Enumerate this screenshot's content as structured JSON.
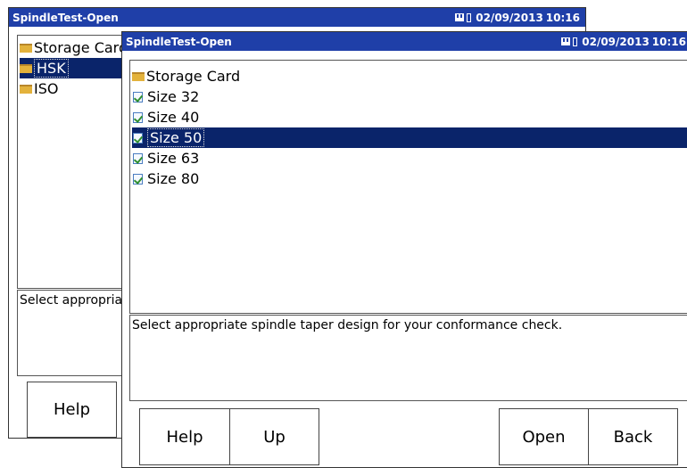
{
  "back_window": {
    "title": "SpindleTest-Open",
    "date": "02/09/2013",
    "time": "10:16",
    "tree": [
      {
        "label": "Storage Card",
        "icon": "folder",
        "selected": false
      },
      {
        "label": "HSK",
        "icon": "folder",
        "selected": true
      },
      {
        "label": "ISO",
        "icon": "folder",
        "selected": false
      }
    ],
    "description": "Select appropriate spindle taper design for your conformance check.",
    "help_label": "Help"
  },
  "front_window": {
    "title": "SpindleTest-Open",
    "date": "02/09/2013",
    "time": "10:16",
    "tree": [
      {
        "label": "Storage Card",
        "icon": "folder",
        "selected": false
      },
      {
        "label": "Size 32",
        "icon": "file",
        "selected": false
      },
      {
        "label": "Size 40",
        "icon": "file",
        "selected": false
      },
      {
        "label": "Size 50",
        "icon": "file",
        "selected": true
      },
      {
        "label": "Size 63",
        "icon": "file",
        "selected": false
      },
      {
        "label": "Size 80",
        "icon": "file",
        "selected": false
      }
    ],
    "description": "Select appropriate spindle taper design for your conformance check.",
    "buttons": {
      "help": "Help",
      "up": "Up",
      "open": "Open",
      "back": "Back"
    }
  },
  "colors": {
    "titlebar": "#1f3fa8",
    "selection": "#0a246a",
    "folder": "#e3b23c"
  }
}
